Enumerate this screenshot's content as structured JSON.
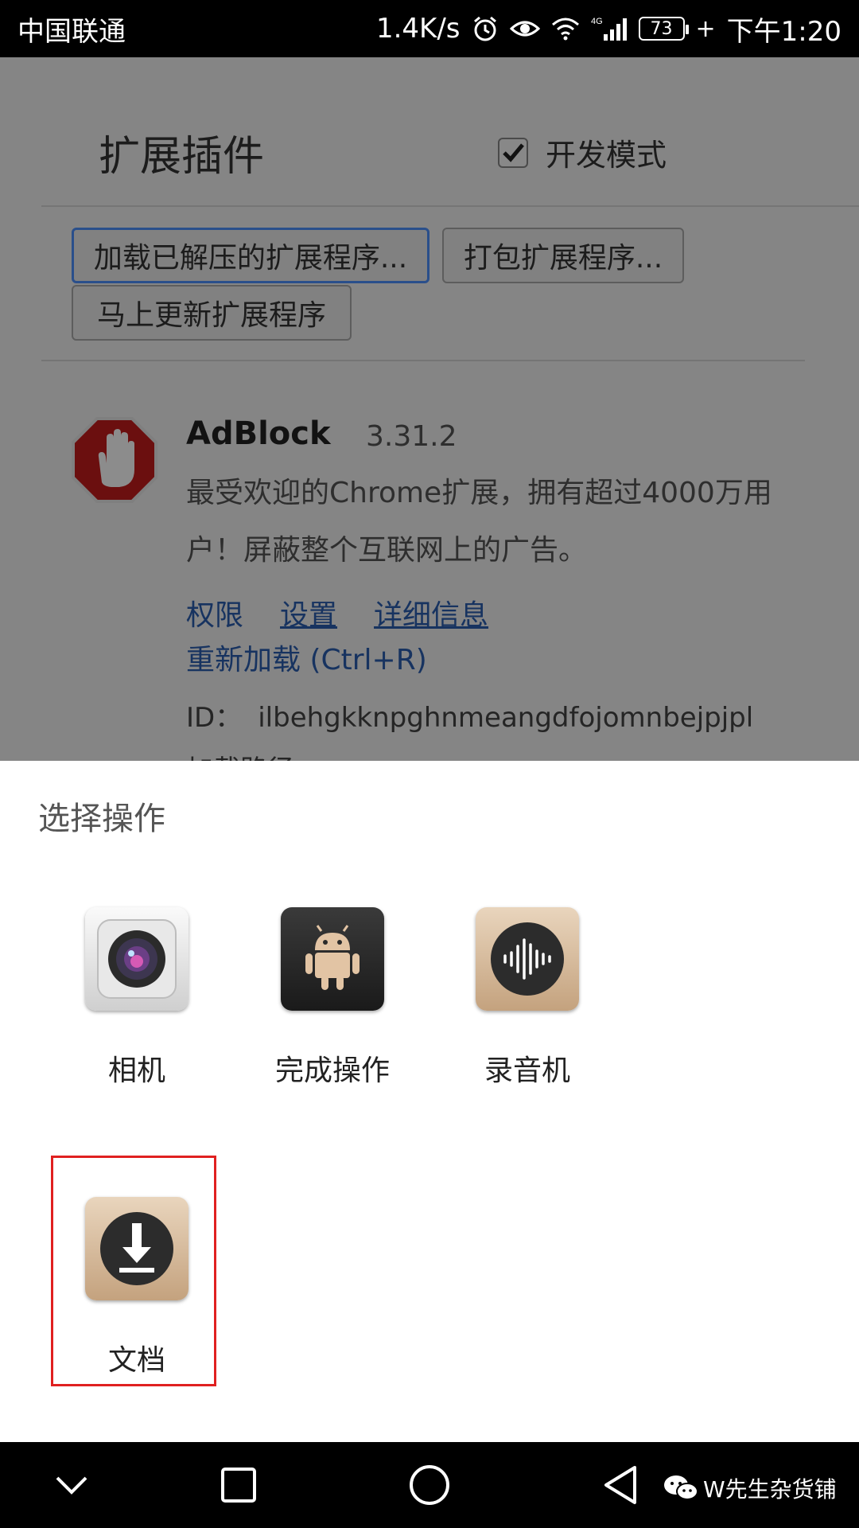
{
  "status_bar": {
    "carrier": "中国联通",
    "net_speed": "1.4K/s",
    "network_type": "4G",
    "battery": "73",
    "time": "下午1:20",
    "icons": [
      "alarm-icon",
      "eye-icon",
      "wifi-icon",
      "signal-icon",
      "battery-icon",
      "charging-icon"
    ]
  },
  "extensions_page": {
    "title": "扩展插件",
    "developer_mode": {
      "label": "开发模式",
      "checked": true
    },
    "buttons": {
      "load_unpacked": "加载已解压的扩展程序...",
      "pack": "打包扩展程序...",
      "update_now": "马上更新扩展程序"
    },
    "extension": {
      "name": "AdBlock",
      "version": "3.31.2",
      "description": "最受欢迎的Chrome扩展，拥有超过4000万用户！屏蔽整个互联网上的广告。",
      "links": {
        "permissions": "权限",
        "settings": "设置",
        "details": "详细信息",
        "reload": "重新加载 (Ctrl+R)"
      },
      "id_label": "ID：",
      "id_value": "ilbehgkknpghnmeangdfojomnbejpjpl",
      "path_label": "加载路径"
    }
  },
  "chooser_sheet": {
    "title": "选择操作",
    "apps": [
      {
        "label": "相机",
        "icon": "camera-icon"
      },
      {
        "label": "完成操作",
        "icon": "android-icon"
      },
      {
        "label": "录音机",
        "icon": "sound-recorder-icon"
      },
      {
        "label": "文档",
        "icon": "download-document-icon",
        "highlighted": true
      }
    ]
  },
  "nav_bar": {
    "icons": [
      "chevron-down-icon",
      "recents-square-icon",
      "home-circle-icon",
      "back-triangle-icon"
    ],
    "watermark": "W先生杂货铺"
  },
  "colors": {
    "link": "#2a5db0",
    "highlight_border": "#e02020",
    "focused_button_border": "#4d90fe"
  }
}
